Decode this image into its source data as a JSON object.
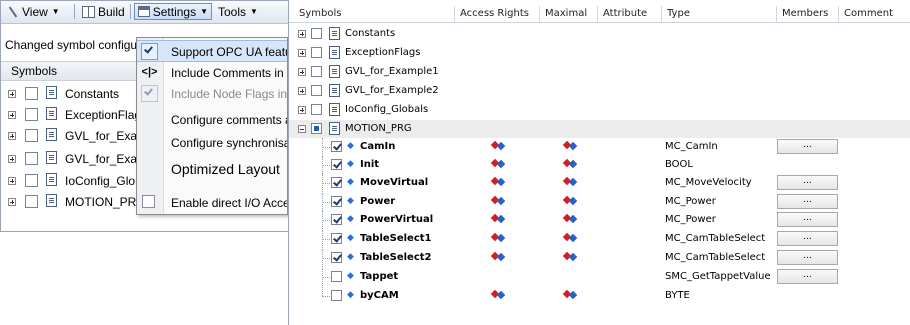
{
  "toolbar": {
    "view_label": "View",
    "build_label": "Build",
    "settings_label": "Settings",
    "tools_label": "Tools"
  },
  "status_text": "Changed symbol configu",
  "left_panel": {
    "header": "Symbols",
    "items": [
      {
        "label": "Constants"
      },
      {
        "label": "ExceptionFlag"
      },
      {
        "label": "GVL_for_Exar"
      },
      {
        "label": "GVL_for_Exar"
      },
      {
        "label": "IoConfig_Glo"
      },
      {
        "label": "MOTION_PRG"
      }
    ]
  },
  "settings_menu": {
    "items": [
      {
        "label": "Support OPC UA featur",
        "state": "checked",
        "selected": true
      },
      {
        "label": "Include Comments in XN",
        "state": "code-icon"
      },
      {
        "label": "Include Node Flags in X",
        "state": "checked-disabled"
      },
      {
        "label": "Configure comments ar",
        "state": "none"
      },
      {
        "label": "Configure synchronisat",
        "state": "none"
      },
      {
        "label": "Optimized Layout",
        "state": "none"
      },
      {
        "label": "Enable direct I/O Acces",
        "state": "unchecked"
      }
    ]
  },
  "right_panel": {
    "columns": [
      "Symbols",
      "Access Rights",
      "Maximal",
      "Attribute",
      "Type",
      "Members",
      "Comment"
    ],
    "groups": [
      {
        "label": "Constants"
      },
      {
        "label": "ExceptionFlags"
      },
      {
        "label": "GVL_for_Example1"
      },
      {
        "label": "GVL_for_Example2"
      },
      {
        "label": "IoConfig_Globals"
      },
      {
        "label": "MOTION_PRG"
      }
    ],
    "children": [
      {
        "name": "CamIn",
        "checked": true,
        "type": "MC_CamIn",
        "members": "..."
      },
      {
        "name": "Init",
        "checked": true,
        "type": "BOOL",
        "members": ""
      },
      {
        "name": "MoveVirtual",
        "checked": true,
        "type": "MC_MoveVelocity",
        "members": "..."
      },
      {
        "name": "Power",
        "checked": true,
        "type": "MC_Power",
        "members": "..."
      },
      {
        "name": "PowerVirtual",
        "checked": true,
        "type": "MC_Power",
        "members": "..."
      },
      {
        "name": "TableSelect1",
        "checked": true,
        "type": "MC_CamTableSelect",
        "members": "..."
      },
      {
        "name": "TableSelect2",
        "checked": true,
        "type": "MC_CamTableSelect",
        "members": "..."
      },
      {
        "name": "Tappet",
        "checked": false,
        "type": "SMC_GetTappetValue",
        "members": "..."
      },
      {
        "name": "byCAM",
        "checked": false,
        "type": "BYTE",
        "members": ""
      }
    ]
  },
  "colors": {
    "menu_selection": "#d6e6fa",
    "access_red": "#d02020",
    "access_blue": "#2a5fc8"
  }
}
